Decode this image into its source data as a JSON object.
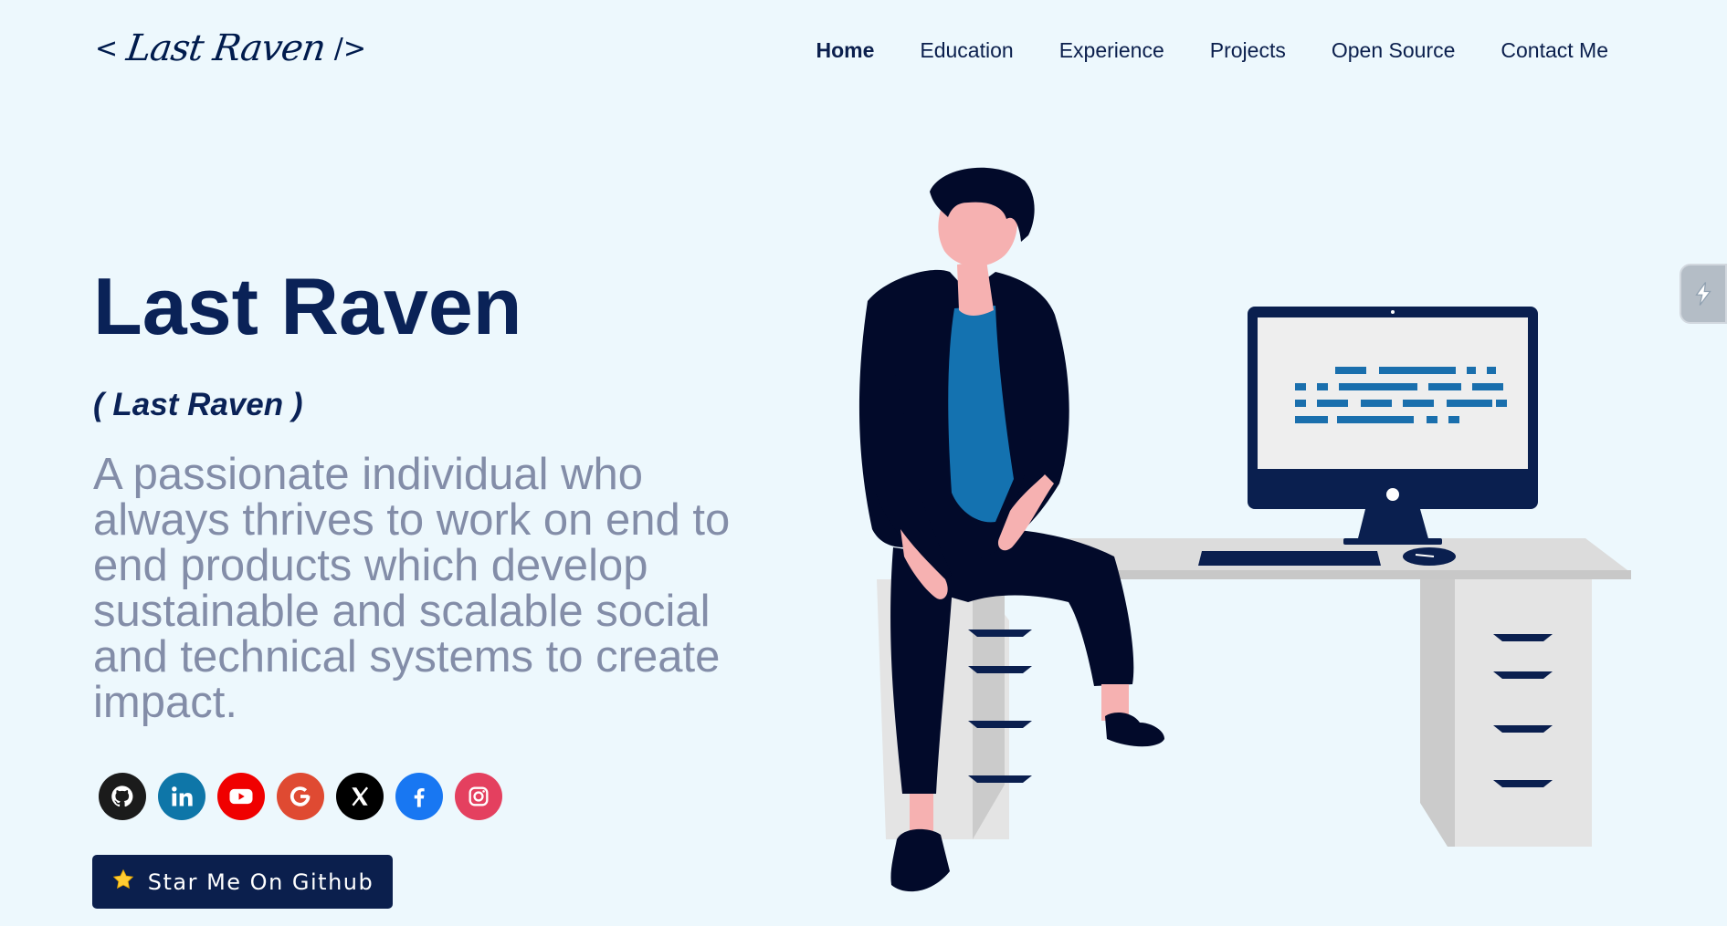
{
  "header": {
    "logo": {
      "open": "<",
      "signature": "Last Raven",
      "close": "/>"
    },
    "nav": [
      "Home",
      "Education",
      "Experience",
      "Projects",
      "Open Source",
      "Contact Me"
    ],
    "active_nav": "Home"
  },
  "hero": {
    "title": "Last Raven",
    "subtitle": "( Last Raven )",
    "description": "A passionate individual who always thrives to work on end to end products which develop sustainable and scalable social and technical systems to create impact."
  },
  "socials": [
    {
      "icon": "github-icon",
      "color": "#1b1b1b"
    },
    {
      "icon": "linkedin-icon",
      "color": "#0e76a8"
    },
    {
      "icon": "youtube-icon",
      "color": "#f00000"
    },
    {
      "icon": "google-icon",
      "color": "#df4a32"
    },
    {
      "icon": "x-icon",
      "color": "#000000"
    },
    {
      "icon": "facebook-icon",
      "color": "#1877f2"
    },
    {
      "icon": "instagram-icon",
      "color": "#e4405f"
    }
  ],
  "cta": {
    "icon": "star-icon",
    "label": "Star Me On Github"
  },
  "colors": {
    "background": "#edf8fd",
    "primary": "#0a2257",
    "muted_text": "#838da8",
    "shirt": "#1472b0"
  }
}
